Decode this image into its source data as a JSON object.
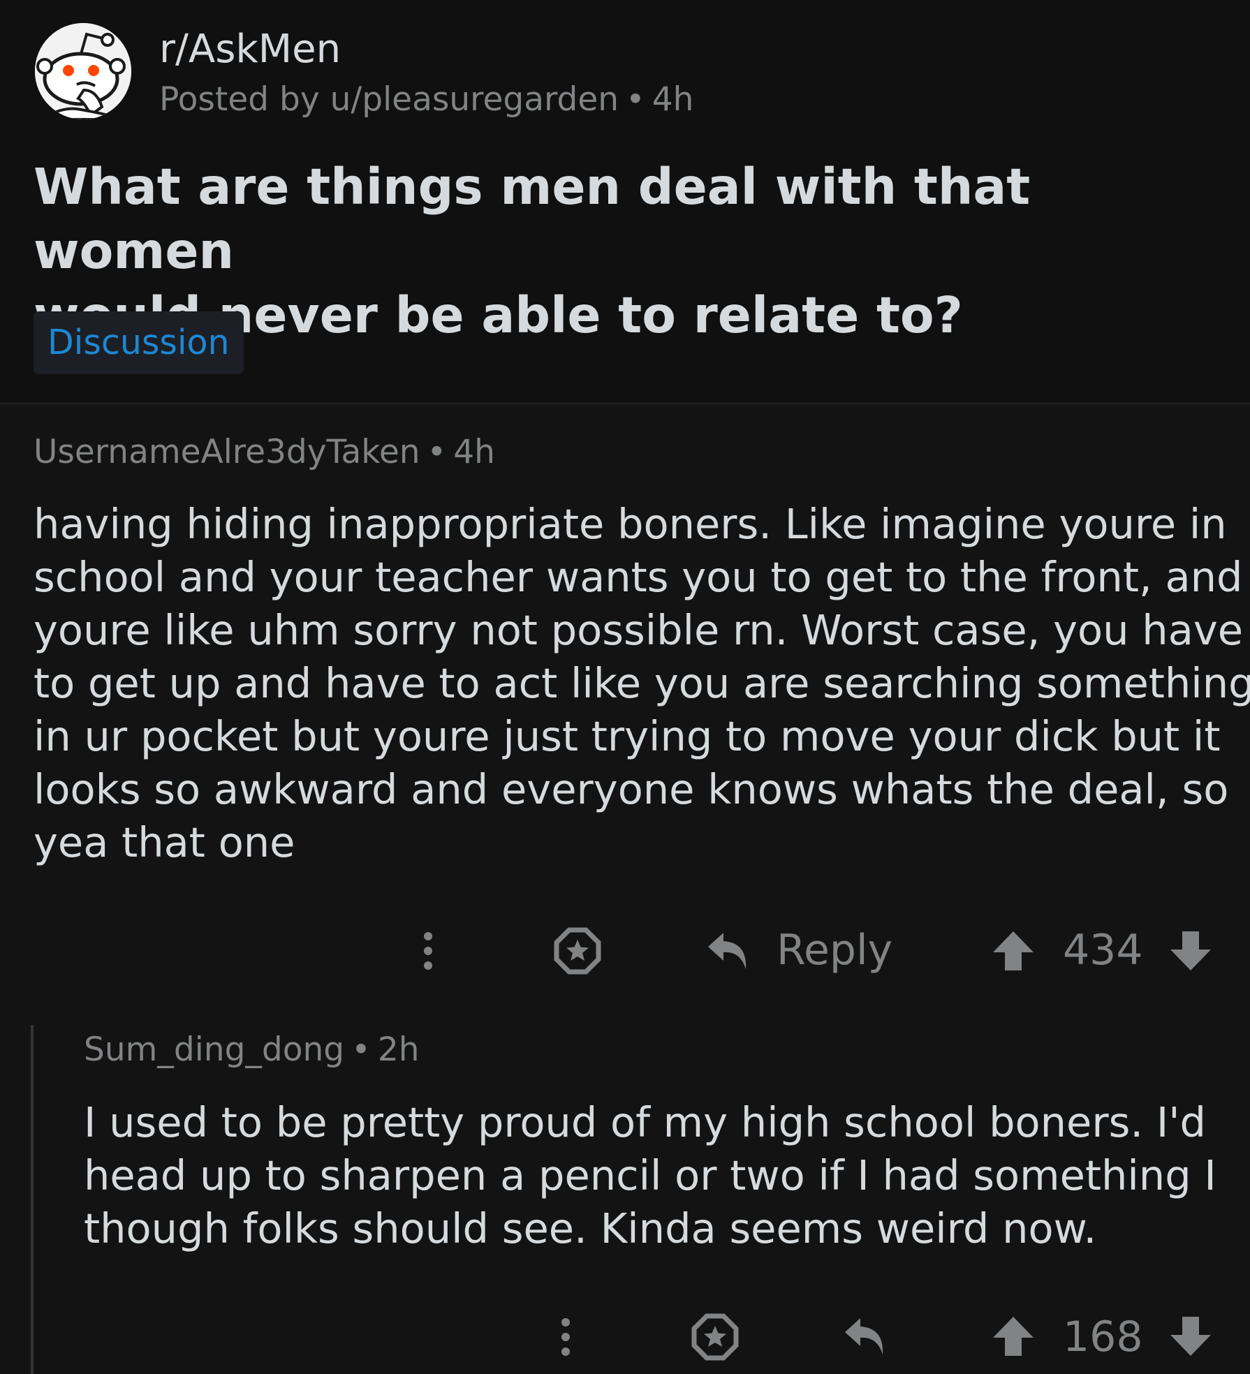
{
  "post": {
    "subreddit": "r/AskMen",
    "posted_by_prefix": "Posted by",
    "author": "u/pleasuregarden",
    "age": "4h",
    "title_line1": "What are things men deal with that women",
    "title_line2": "would never be able to relate to?",
    "flair": "Discussion"
  },
  "comments": [
    {
      "author": "UsernameAlre3dyTaken",
      "age": "4h",
      "body_lines": [
        "having hiding inappropriate boners. Like imagine youre in",
        "school and your teacher wants you to get to the front, and",
        "youre like uhm sorry not possible rn. Worst case, you have",
        "to get up and have to act like you are searching something",
        "in ur pocket but youre just trying to move your dick but it",
        "looks so awkward and everyone knows whats the deal, so",
        "yea that one"
      ],
      "reply_label": "Reply",
      "score": "434"
    },
    {
      "author": "Sum_ding_dong",
      "age": "2h",
      "body_lines": [
        "I used to be pretty proud of my high school boners. I'd",
        "head up to sharpen a pencil or two if I had something I",
        "though folks should see. Kinda seems weird now."
      ],
      "score": "168"
    }
  ],
  "icons": {
    "avatar": "reddit-snoo-avatar",
    "more": "more-options-icon",
    "award": "award-icon",
    "reply": "reply-arrow-icon",
    "upvote": "upvote-arrow-icon",
    "downvote": "downvote-arrow-icon"
  },
  "colors": {
    "background": "#131313",
    "text": "#d7dadc",
    "muted": "#818384",
    "flair_text": "#1d88d4",
    "flair_bg": "#1c1f25"
  },
  "separator": "•"
}
